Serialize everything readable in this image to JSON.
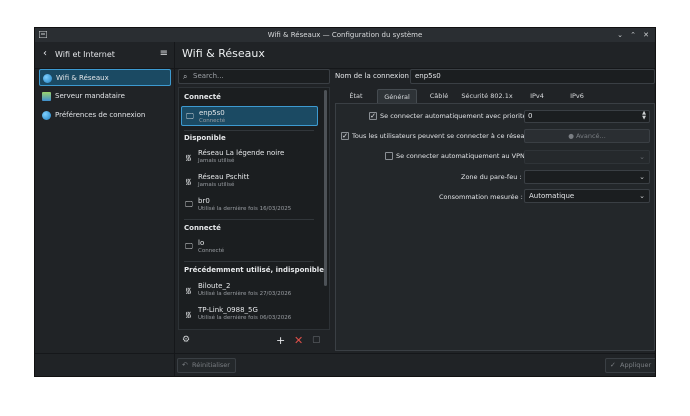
{
  "window": {
    "title": "Wifi & Réseaux — Configuration du système",
    "controls": [
      "⌄",
      "⌃",
      "✕"
    ]
  },
  "header": {
    "back_title": "Wifi et Internet",
    "page_title": "Wifi & Réseaux"
  },
  "sidebar": {
    "items": [
      {
        "label": "Wifi & Réseaux",
        "selected": true,
        "icon": "globe-icon"
      },
      {
        "label": "Serveur mandataire",
        "selected": false,
        "icon": "proxy-icon"
      },
      {
        "label": "Préférences de connexion",
        "selected": false,
        "icon": "globe-icon"
      }
    ]
  },
  "search": {
    "placeholder": "Search..."
  },
  "connections": {
    "groups": [
      {
        "title": "Connecté",
        "items": [
          {
            "name": "enp5s0",
            "status": "Connecté",
            "icon": "ethernet-icon",
            "selected": true
          }
        ]
      },
      {
        "title": "Disponible",
        "items": [
          {
            "name": "Réseau La légende noire",
            "status": "Jamais utilisé",
            "icon": "wifi-icon"
          },
          {
            "name": "Réseau Pschitt",
            "status": "Jamais utilisé",
            "icon": "wifi-icon"
          },
          {
            "name": "br0",
            "status": "Utilisé la dernière fois 16/03/2025",
            "icon": "ethernet-icon"
          }
        ]
      },
      {
        "title": "Connecté",
        "items": [
          {
            "name": "lo",
            "status": "Connecté",
            "icon": "ethernet-icon"
          }
        ]
      },
      {
        "title": "Précédemment utilisé, indisponible",
        "items": [
          {
            "name": "Biloute_2",
            "status": "Utilisé la dernière fois 27/03/2026",
            "icon": "wifi-icon"
          },
          {
            "name": "TP-Link_0988_5G",
            "status": "Utilisé la dernière fois 06/03/2026",
            "icon": "wifi-icon"
          }
        ]
      }
    ]
  },
  "details": {
    "name_label": "Nom de la connexion :",
    "name_value": "enp5s0",
    "tabs": [
      {
        "label": "État",
        "active": false
      },
      {
        "label": "Général",
        "active": true
      },
      {
        "label": "Câblé",
        "active": false
      },
      {
        "label": "Sécurité 802.1x",
        "active": false
      },
      {
        "label": "IPv4",
        "active": false
      },
      {
        "label": "IPv6",
        "active": false
      }
    ],
    "auto_connect_label": "Se connecter automatiquement avec priorité",
    "auto_connect_checked": true,
    "priority_value": "0",
    "all_users_label": "Tous les utilisateurs peuvent se connecter à ce réseau",
    "all_users_checked": true,
    "advanced_button": "Avancé...",
    "vpn_label": "Se connecter automatiquement au VPN",
    "vpn_checked": false,
    "firewall_label": "Zone du pare-feu :",
    "firewall_value": "",
    "metered_label": "Consommation mesurée :",
    "metered_value": "Automatique"
  },
  "footer": {
    "reset_label": "Réinitialiser",
    "apply_label": "Appliquer"
  }
}
